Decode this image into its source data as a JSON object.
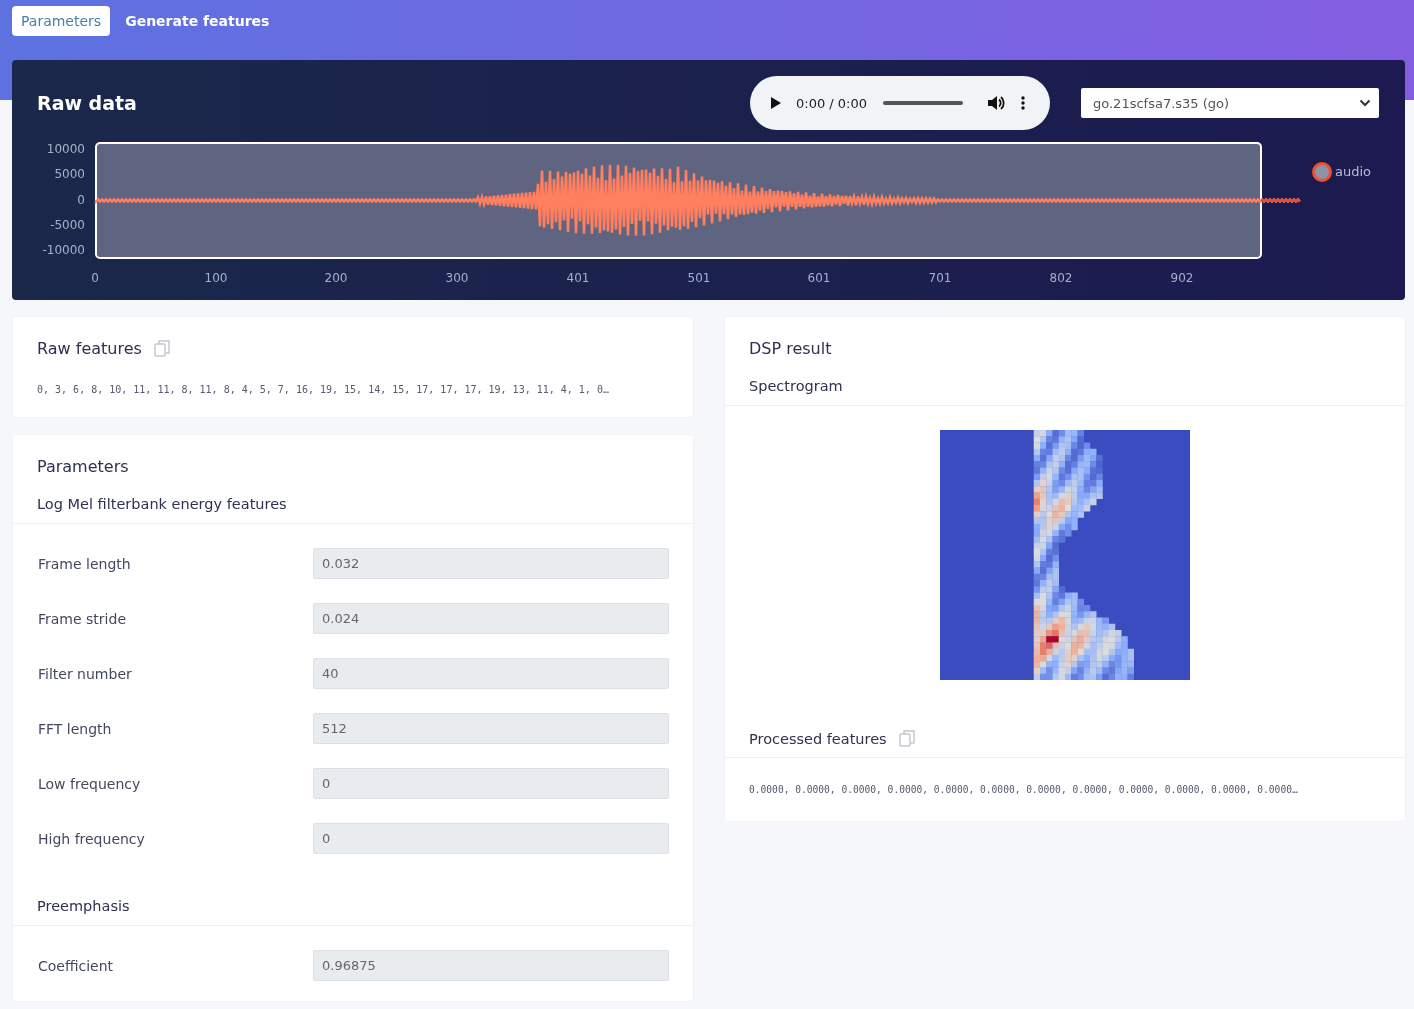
{
  "tabs": [
    {
      "label": "Parameters",
      "selected": true
    },
    {
      "label": "Generate features",
      "selected": false
    }
  ],
  "raw_data": {
    "title": "Raw data",
    "player": {
      "time": "0:00 / 0:00",
      "level": 0
    },
    "sample_select": {
      "value": "go.21scfsa7.s35 (go)"
    },
    "y_ticks": [
      "10000",
      "5000",
      "0",
      "-5000",
      "-10000"
    ],
    "x_ticks": [
      "0",
      "100",
      "200",
      "300",
      "401",
      "501",
      "601",
      "701",
      "802",
      "902"
    ],
    "legend": "audio"
  },
  "raw_features": {
    "title": "Raw features",
    "values": "0, 3, 6, 8, 10, 11, 11, 8, 11, 8, 4, 5, 7, 16, 19, 15, 14, 15, 17, 17, 17, 19, 13, 11, 4, 1, 0…"
  },
  "parameters": {
    "title": "Parameters",
    "groups": [
      {
        "title": "Log Mel filterbank energy features",
        "fields": [
          {
            "label": "Frame length",
            "value": "0.032"
          },
          {
            "label": "Frame stride",
            "value": "0.024"
          },
          {
            "label": "Filter number",
            "value": "40"
          },
          {
            "label": "FFT length",
            "value": "512"
          },
          {
            "label": "Low frequency",
            "value": "0"
          },
          {
            "label": "High frequency",
            "value": "0"
          }
        ]
      },
      {
        "title": "Preemphasis",
        "fields": [
          {
            "label": "Coefficient",
            "value": "0.96875"
          }
        ]
      }
    ]
  },
  "dsp_result": {
    "title": "DSP result",
    "spectrogram_title": "Spectrogram",
    "processed_title": "Processed features",
    "values": "0.0000, 0.0000, 0.0000, 0.0000, 0.0000, 0.0000, 0.0000, 0.0000, 0.0000, 0.0000, 0.0000, 0.0000…"
  }
}
